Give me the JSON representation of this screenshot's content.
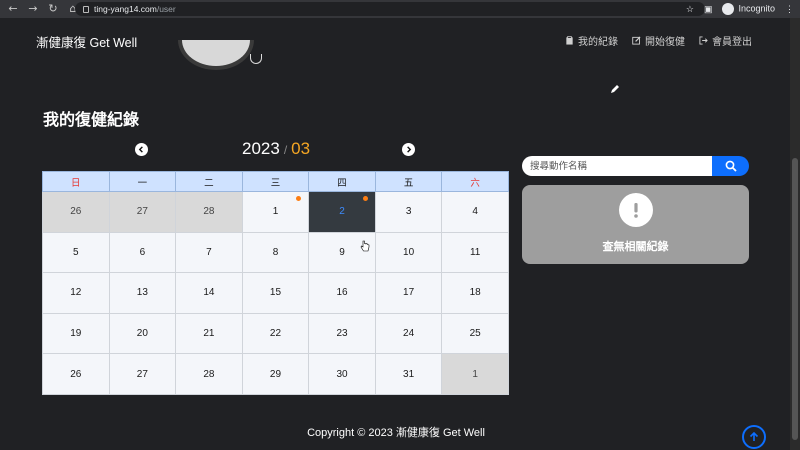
{
  "browser": {
    "url_host": "ting-yang14.com",
    "url_path": "/user",
    "profile_label": "Incognito"
  },
  "header": {
    "brand": "漸健康復 Get Well",
    "nav": [
      {
        "label": "我的紀錄",
        "icon": "clipboard-icon"
      },
      {
        "label": "開始復健",
        "icon": "edit-icon"
      },
      {
        "label": "會員登出",
        "icon": "logout-icon"
      }
    ]
  },
  "section": {
    "title": "我的復健紀錄"
  },
  "calendar": {
    "year": "2023",
    "separator": "/",
    "month": "03",
    "weekdays": [
      "日",
      "一",
      "二",
      "三",
      "四",
      "五",
      "六"
    ],
    "weeks": [
      [
        "26",
        "27",
        "28",
        "1",
        "2",
        "3",
        "4"
      ],
      [
        "5",
        "6",
        "7",
        "8",
        "9",
        "10",
        "11"
      ],
      [
        "12",
        "13",
        "14",
        "15",
        "16",
        "17",
        "18"
      ],
      [
        "19",
        "20",
        "21",
        "22",
        "23",
        "24",
        "25"
      ],
      [
        "26",
        "27",
        "28",
        "29",
        "30",
        "31",
        "1"
      ]
    ],
    "selected_day": "2",
    "days_with_records": [
      "1",
      "2"
    ]
  },
  "search": {
    "placeholder": "搜尋動作名稱",
    "value": ""
  },
  "empty_state": {
    "message": "查無相關紀錄",
    "icon": "exclamation-icon"
  },
  "footer": {
    "copyright": "Copyright © 2023 漸健康復 Get Well"
  },
  "colors": {
    "accent": "#0d6efd",
    "month": "#f5a623",
    "record_dot": "#fd7e14",
    "weekend": "#e53935"
  }
}
